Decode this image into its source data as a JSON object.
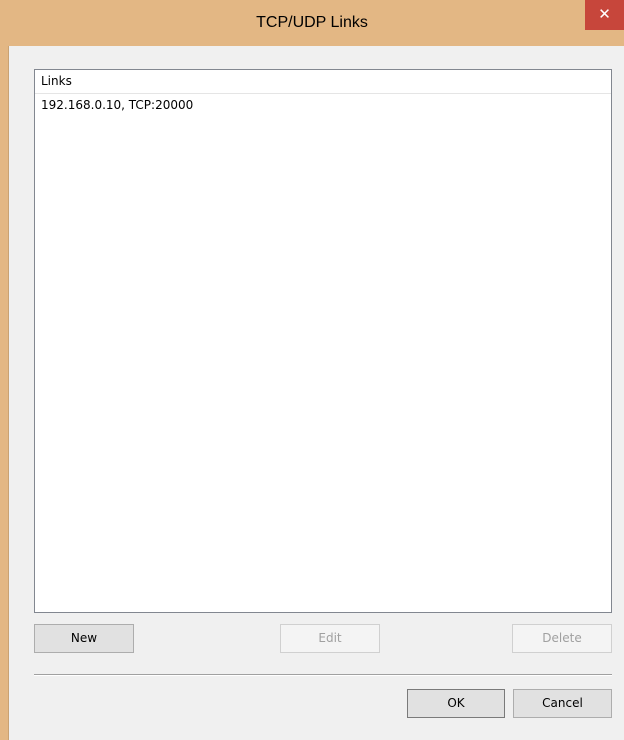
{
  "window": {
    "title": "TCP/UDP Links",
    "close_label": "✕"
  },
  "links_list": {
    "column_header": "Links",
    "items": [
      "192.168.0.10, TCP:20000"
    ]
  },
  "buttons": {
    "new_label": "New",
    "edit_label": "Edit",
    "delete_label": "Delete",
    "ok_label": "OK",
    "cancel_label": "Cancel"
  },
  "colors": {
    "titlebar": "#e3b784",
    "close_button": "#c7463b",
    "client_background": "#f0f0f0"
  }
}
